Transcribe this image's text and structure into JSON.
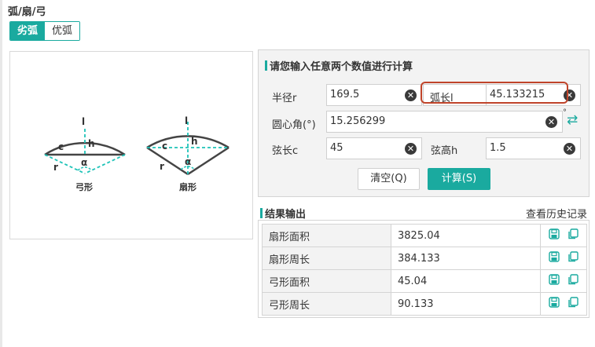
{
  "page": {
    "title": "弧/扇/弓"
  },
  "tabs": [
    {
      "label": "劣弧",
      "active": true
    },
    {
      "label": "优弧",
      "active": false
    }
  ],
  "diagram": {
    "left_shape_label": "弓形",
    "right_shape_label": "扇形",
    "symbols": {
      "l": "l",
      "h": "h",
      "c": "c",
      "r": "r",
      "alpha": "α"
    }
  },
  "calc": {
    "section_title": "请您输入任意两个数值进行计算",
    "fields": {
      "radius": {
        "label": "半径r",
        "value": "169.5"
      },
      "arc_length": {
        "label": "弧长l",
        "value": "45.133215"
      },
      "angle": {
        "label": "圆心角(°)",
        "value": "15.256299",
        "unit": "°"
      },
      "chord": {
        "label": "弦长c",
        "value": "45"
      },
      "height": {
        "label": "弦高h",
        "value": "1.5"
      }
    },
    "clear_glyph": "✕",
    "swap_glyph": "⇄",
    "clear_button": "清空(Q)",
    "calc_button": "计算(S)"
  },
  "results": {
    "section_title": "结果输出",
    "history_link": "查看历史记录",
    "rows": [
      {
        "name": "扇形面积",
        "value": "3825.04"
      },
      {
        "name": "扇形周长",
        "value": "384.133"
      },
      {
        "name": "弓形面积",
        "value": "45.04"
      },
      {
        "name": "弓形周长",
        "value": "90.133"
      }
    ]
  },
  "colors": {
    "accent": "#1aaa9f",
    "highlight": "#c0442a",
    "dashed": "#1ec3b8",
    "shape_stroke": "#444444"
  }
}
